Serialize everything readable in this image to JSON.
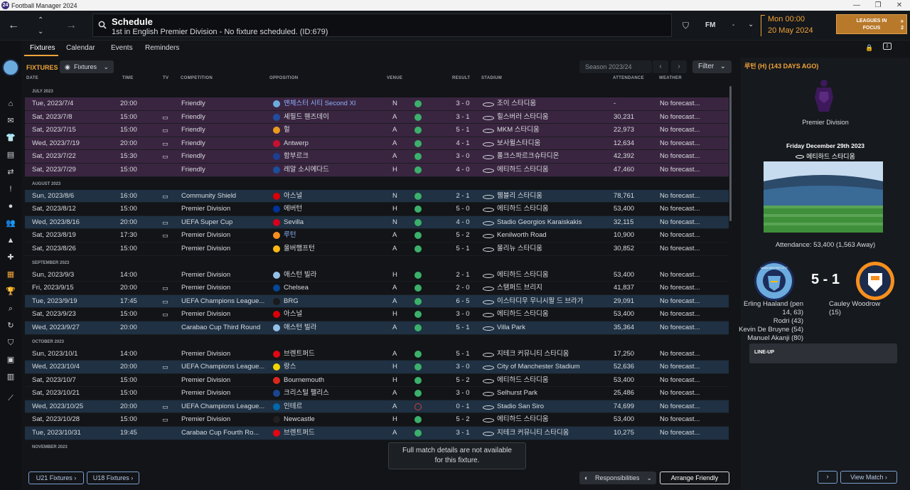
{
  "window": {
    "title": "Football Manager 2024",
    "logo_text": "24"
  },
  "header": {
    "title": "Schedule",
    "subtitle": "1st in English Premier Division - No fixture scheduled. (ID:679)",
    "manager_badge": "FM",
    "dash": "-",
    "date_time": "Mon 00:00",
    "date": "20 May 2024",
    "focus_button": "LEAGUES IN FOCUS",
    "focus_count": "2"
  },
  "tabs": [
    "Fixtures",
    "Calendar",
    "Events",
    "Reminders"
  ],
  "controls": {
    "section_title": "FIXTURES",
    "view_dropdown": "Fixtures",
    "season": "Season 2023/24",
    "filter": "Filter"
  },
  "columns": [
    "DATE",
    "TIME",
    "TV",
    "COMPETITION",
    "OPPOSITION",
    "VENUE",
    "RESULT",
    "STADIUM",
    "ATTENDANCE",
    "WEATHER"
  ],
  "months": [
    {
      "label": "JULY 2023",
      "rows": [
        {
          "date": "Tue, 2023/7/4",
          "time": "20:00",
          "tv": false,
          "comp": "Friendly",
          "opp": "맨체스터 시티 Second XI",
          "opp_hl": true,
          "crest": "#6cabdd",
          "venue": "N",
          "result": "win",
          "score": "3 - 0",
          "stadium": "조이 스타디움",
          "att": "-",
          "weather": "No forecast...",
          "style": "friendly"
        },
        {
          "date": "Sat, 2023/7/8",
          "time": "15:00",
          "tv": true,
          "comp": "Friendly",
          "opp": "셰필드 웬즈데이",
          "opp_hl": false,
          "crest": "#1f4ea1",
          "venue": "A",
          "result": "win",
          "score": "3 - 1",
          "stadium": "힐스버러 스타디움",
          "att": "30,231",
          "weather": "No forecast...",
          "style": "friendly"
        },
        {
          "date": "Sat, 2023/7/15",
          "time": "15:00",
          "tv": true,
          "comp": "Friendly",
          "opp": "헐",
          "opp_hl": false,
          "crest": "#e89b1c",
          "venue": "A",
          "result": "win",
          "score": "5 - 1",
          "stadium": "MKM 스타디움",
          "att": "22,973",
          "weather": "No forecast...",
          "style": "friendly"
        },
        {
          "date": "Wed, 2023/7/19",
          "time": "20:00",
          "tv": true,
          "comp": "Friendly",
          "opp": "Antwerp",
          "opp_hl": false,
          "crest": "#c8102e",
          "venue": "A",
          "result": "win",
          "score": "4 - 1",
          "stadium": "보사윌스타디움",
          "att": "12,634",
          "weather": "No forecast...",
          "style": "friendly"
        },
        {
          "date": "Sat, 2023/7/22",
          "time": "15:30",
          "tv": true,
          "comp": "Friendly",
          "opp": "함부르크",
          "opp_hl": false,
          "crest": "#1c3f94",
          "venue": "A",
          "result": "win",
          "score": "3 - 0",
          "stadium": "폴크스파르크슈타디온",
          "att": "42,392",
          "weather": "No forecast...",
          "style": "friendly"
        },
        {
          "date": "Sat, 2023/7/29",
          "time": "15:00",
          "tv": false,
          "comp": "Friendly",
          "opp": "레알 소시에다드",
          "opp_hl": false,
          "crest": "#1a4f9c",
          "venue": "H",
          "result": "win",
          "score": "4 - 0",
          "stadium": "에티하드 스타디움",
          "att": "47,460",
          "weather": "No forecast...",
          "style": "friendly"
        }
      ]
    },
    {
      "label": "AUGUST 2023",
      "rows": [
        {
          "date": "Sun, 2023/8/6",
          "time": "16:00",
          "tv": true,
          "comp": "Community Shield",
          "opp": "아스널",
          "opp_hl": false,
          "crest": "#db0007",
          "venue": "N",
          "result": "win",
          "score": "2 - 1",
          "stadium": "웸블리 스타디움",
          "att": "78,761",
          "weather": "No forecast...",
          "style": "blue"
        },
        {
          "date": "Sat, 2023/8/12",
          "time": "15:00",
          "tv": false,
          "comp": "Premier Division",
          "opp": "에버턴",
          "opp_hl": false,
          "crest": "#003399",
          "venue": "H",
          "result": "win",
          "score": "5 - 0",
          "stadium": "에티하드 스타디움",
          "att": "53,400",
          "weather": "No forecast...",
          "style": ""
        },
        {
          "date": "Wed, 2023/8/16",
          "time": "20:00",
          "tv": true,
          "comp": "UEFA Super Cup",
          "opp": "Sevilla",
          "opp_hl": false,
          "crest": "#d9001b",
          "venue": "N",
          "result": "win",
          "score": "4 - 0",
          "stadium": "Stadio Georgios Karaiskakis",
          "att": "32,115",
          "weather": "No forecast...",
          "style": "blue"
        },
        {
          "date": "Sat, 2023/8/19",
          "time": "17:30",
          "tv": true,
          "comp": "Premier Division",
          "opp": "루턴",
          "opp_hl": true,
          "crest": "#f78f1e",
          "venue": "A",
          "result": "win",
          "score": "5 - 2",
          "stadium": "Kenilworth Road",
          "att": "10,900",
          "weather": "No forecast...",
          "style": ""
        },
        {
          "date": "Sat, 2023/8/26",
          "time": "15:00",
          "tv": false,
          "comp": "Premier Division",
          "opp": "울버햄프턴",
          "opp_hl": false,
          "crest": "#fdb913",
          "venue": "A",
          "result": "win",
          "score": "5 - 1",
          "stadium": "몰리뉴 스타디움",
          "att": "30,852",
          "weather": "No forecast...",
          "style": ""
        }
      ]
    },
    {
      "label": "SEPTEMBER 2023",
      "rows": [
        {
          "date": "Sun, 2023/9/3",
          "time": "14:00",
          "tv": false,
          "comp": "Premier Division",
          "opp": "애스턴 빌라",
          "opp_hl": false,
          "crest": "#95bfe5",
          "venue": "H",
          "result": "win",
          "score": "2 - 1",
          "stadium": "에티하드 스타디움",
          "att": "53,400",
          "weather": "No forecast...",
          "style": ""
        },
        {
          "date": "Fri, 2023/9/15",
          "time": "20:00",
          "tv": true,
          "comp": "Premier Division",
          "opp": "Chelsea",
          "opp_hl": false,
          "crest": "#034694",
          "venue": "A",
          "result": "win",
          "score": "2 - 0",
          "stadium": "스탬퍼드 브리지",
          "att": "41,837",
          "weather": "No forecast...",
          "style": ""
        },
        {
          "date": "Tue, 2023/9/19",
          "time": "17:45",
          "tv": true,
          "comp": "UEFA Champions League...",
          "opp": "BRG",
          "opp_hl": false,
          "crest": "#1a1a1a",
          "venue": "A",
          "result": "win",
          "score": "6 - 5",
          "stadium": "이스타디우 무니시팔 드 브라가",
          "att": "29,091",
          "weather": "No forecast...",
          "style": "blue"
        },
        {
          "date": "Sat, 2023/9/23",
          "time": "15:00",
          "tv": true,
          "comp": "Premier Division",
          "opp": "아스널",
          "opp_hl": false,
          "crest": "#db0007",
          "venue": "H",
          "result": "win",
          "score": "3 - 0",
          "stadium": "에티하드 스타디움",
          "att": "53,400",
          "weather": "No forecast...",
          "style": ""
        },
        {
          "date": "Wed, 2023/9/27",
          "time": "20:00",
          "tv": false,
          "comp": "Carabao Cup Third Round",
          "opp": "애스턴 빌라",
          "opp_hl": false,
          "crest": "#95bfe5",
          "venue": "A",
          "result": "win",
          "score": "5 - 1",
          "stadium": "Villa Park",
          "att": "35,364",
          "weather": "No forecast...",
          "style": "blue"
        }
      ]
    },
    {
      "label": "OCTOBER 2023",
      "rows": [
        {
          "date": "Sun, 2023/10/1",
          "time": "14:00",
          "tv": false,
          "comp": "Premier Division",
          "opp": "브렌트퍼드",
          "opp_hl": false,
          "crest": "#e30613",
          "venue": "A",
          "result": "win",
          "score": "5 - 1",
          "stadium": "지테크 커뮤니티 스타디움",
          "att": "17,250",
          "weather": "No forecast...",
          "style": ""
        },
        {
          "date": "Wed, 2023/10/4",
          "time": "20:00",
          "tv": true,
          "comp": "UEFA Champions League...",
          "opp": "랑스",
          "opp_hl": false,
          "crest": "#f4d500",
          "venue": "H",
          "result": "win",
          "score": "3 - 0",
          "stadium": "City of Manchester Stadium",
          "att": "52,636",
          "weather": "No forecast...",
          "style": "blue"
        },
        {
          "date": "Sat, 2023/10/7",
          "time": "15:00",
          "tv": false,
          "comp": "Premier Division",
          "opp": "Bournemouth",
          "opp_hl": false,
          "crest": "#da291c",
          "venue": "H",
          "result": "win",
          "score": "5 - 2",
          "stadium": "에티하드 스타디움",
          "att": "53,400",
          "weather": "No forecast...",
          "style": ""
        },
        {
          "date": "Sat, 2023/10/21",
          "time": "15:00",
          "tv": false,
          "comp": "Premier Division",
          "opp": "크리스털 팰리스",
          "opp_hl": false,
          "crest": "#1b458f",
          "venue": "A",
          "result": "win",
          "score": "3 - 0",
          "stadium": "Selhurst Park",
          "att": "25,486",
          "weather": "No forecast...",
          "style": ""
        },
        {
          "date": "Wed, 2023/10/25",
          "time": "20:00",
          "tv": true,
          "comp": "UEFA Champions League...",
          "opp": "인테르",
          "opp_hl": false,
          "crest": "#0068a8",
          "venue": "A",
          "result": "loss",
          "score": "0 - 1",
          "stadium": "Stadio San Siro",
          "att": "74,699",
          "weather": "No forecast...",
          "style": "blue"
        },
        {
          "date": "Sat, 2023/10/28",
          "time": "15:00",
          "tv": true,
          "comp": "Premier Division",
          "opp": "Newcastle",
          "opp_hl": false,
          "crest": "#241f20",
          "venue": "H",
          "result": "win",
          "score": "5 - 2",
          "stadium": "에티하드 스타디움",
          "att": "53,400",
          "weather": "No forecast...",
          "style": ""
        },
        {
          "date": "Tue, 2023/10/31",
          "time": "19:45",
          "tv": false,
          "comp": "Carabao Cup Fourth Ro...",
          "opp": "브렌트퍼드",
          "opp_hl": false,
          "crest": "#e30613",
          "venue": "A",
          "result": "win",
          "score": "3 - 1",
          "stadium": "지테크 커뮤니티 스타디움",
          "att": "10,275",
          "weather": "No forecast...",
          "style": "blue"
        }
      ]
    },
    {
      "label": "NOVEMBER 2023",
      "rows": []
    }
  ],
  "tooltip": {
    "line1": "Full match details are not available",
    "line2": "for this fixture."
  },
  "bottom": {
    "u21": "U21 Fixtures",
    "u18": "U18 Fixtures",
    "responsibilities": "Responsibilities",
    "arrange_friendly": "Arrange Friendly"
  },
  "panel": {
    "heading": "루턴 (H) (143 DAYS AGO)",
    "competition": "Premier Division",
    "match_date": "Friday December 29th 2023",
    "stadium": "에티하드 스타디움",
    "attendance": "Attendance: 53,400 (1,563 Away)",
    "score": "5 - 1",
    "home_scorers": [
      "Erling Haaland (pen",
      "14, 63)",
      "Rodri (43)",
      "Kevin De Bruyne (54)",
      "Manuel Akanji (80)"
    ],
    "away_scorers": [
      "Cauley Woodrow",
      "(15)"
    ],
    "lineup": "LINE-UP",
    "view_match": "View Match",
    "home_crest_text": "MANCHESTER CITY"
  },
  "colors": {
    "accent": "#f0a33a",
    "friendly_row": "#3a2540",
    "cup_row": "#1f3143",
    "win": "#3bb06a",
    "loss": "#d04040"
  }
}
